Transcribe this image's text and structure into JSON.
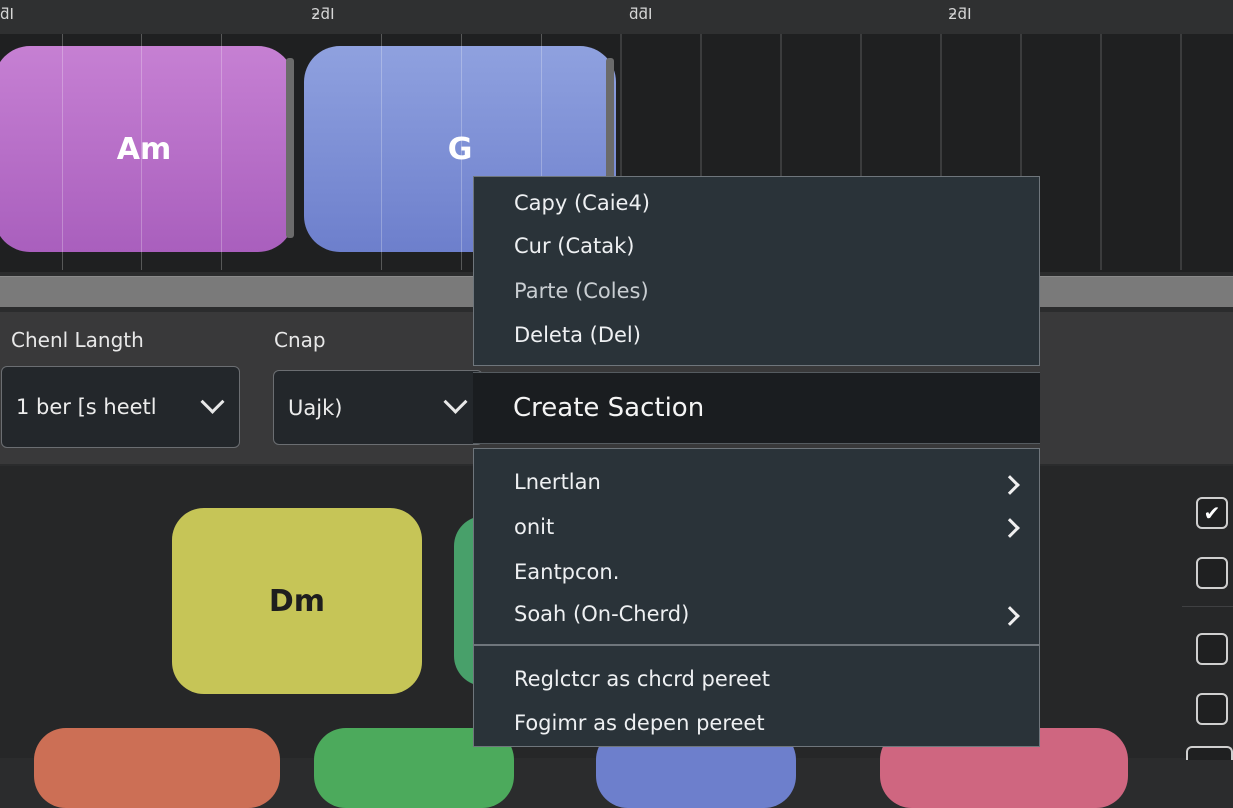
{
  "ruler": {
    "labels": [
      "ƌI",
      "ƻƌI",
      "ƌƌI",
      "ƻƌI"
    ]
  },
  "timeline": {
    "blocks": [
      {
        "label": "Am",
        "color": "#b56dc8"
      },
      {
        "label": "G",
        "color": "#7c8ed6"
      }
    ]
  },
  "controls": {
    "chord_length_label": "Chenl Langth",
    "chord_length_value": "1 ber [s heetl",
    "snap_label": "Cnap",
    "snap_value": "Uajk)"
  },
  "pads": {
    "items": [
      {
        "label": "Dm",
        "color": "#c6c557"
      }
    ]
  },
  "context_menu": {
    "group1": [
      "Capy (Caie4)",
      "Cur (Catak)",
      "Parte (Coles)",
      "Deleta (Del)"
    ],
    "highlighted": "Create Saction",
    "group2": [
      {
        "label": "Lnertlan",
        "submenu": true
      },
      {
        "label": "onit",
        "submenu": true
      },
      {
        "label": "Eantpcon.",
        "submenu": false
      },
      {
        "label": "Soah (On-Cherd)",
        "submenu": true
      }
    ],
    "group3": [
      "Reglctcr as chcrd pereet",
      "Fogimr as depen pereet"
    ]
  },
  "side_checkboxes": [
    {
      "checked": true
    },
    {
      "checked": false
    },
    {
      "checked": false
    },
    {
      "checked": false
    }
  ],
  "icons": {
    "dropdown": "chevron-down-icon",
    "submenu": "chevron-right-icon",
    "check": "check-icon"
  }
}
